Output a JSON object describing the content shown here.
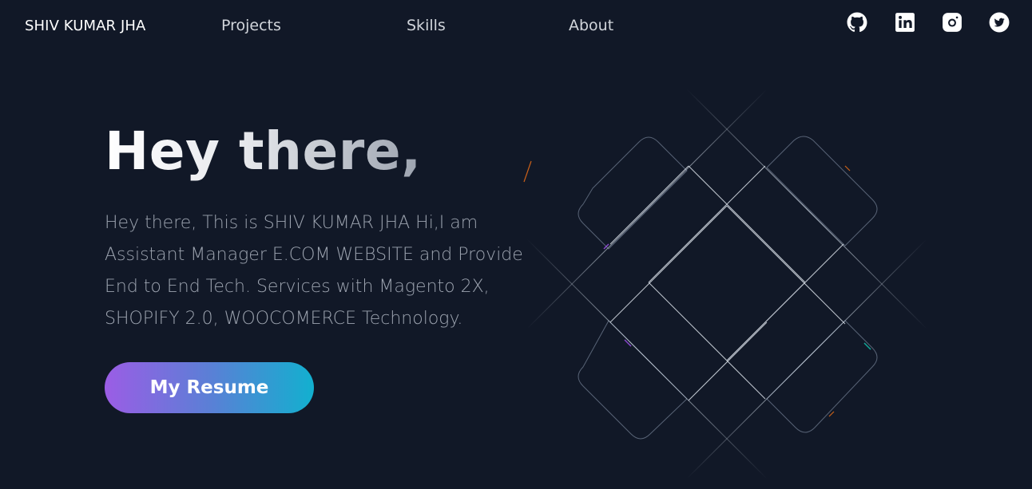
{
  "nav": {
    "brand": "SHIV KUMAR JHA",
    "links": [
      {
        "label": "Projects"
      },
      {
        "label": "Skills"
      },
      {
        "label": "About"
      }
    ],
    "social": [
      {
        "icon": "github-icon"
      },
      {
        "icon": "linkedin-icon"
      },
      {
        "icon": "instagram-icon"
      },
      {
        "icon": "twitter-icon"
      }
    ]
  },
  "hero": {
    "title": "Hey there,",
    "description": "Hey there, This is SHIV KUMAR JHA Hi,I am Assistant Manager E.COM WEBSITE and Provide End to End Tech. Services with Magento 2X, SHOPIFY 2.0, WOOCOMERCE Technology.",
    "button_label": "My Resume"
  },
  "colors": {
    "background": "#111827",
    "button_gradient_start": "#9b5de5",
    "button_gradient_end": "#12b0cf",
    "body_text": "#9ca3af"
  }
}
